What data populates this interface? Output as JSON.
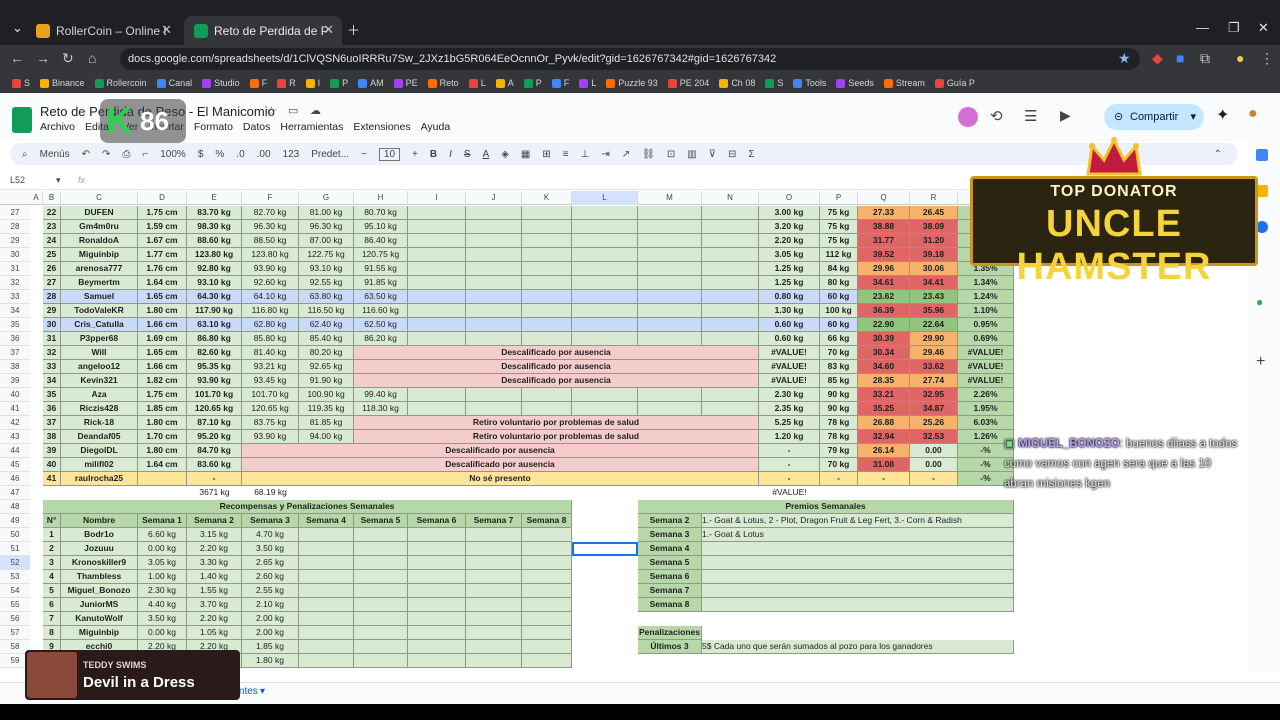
{
  "browser": {
    "tabs": [
      {
        "title": "RollerCoin – Online Bitcoin Mi",
        "active": false
      },
      {
        "title": "Reto de Perdida de Peso - El M",
        "active": true
      }
    ],
    "url": "docs.google.com/spreadsheets/d/1ClVQSN6uoIRRRu7Sw_2JXz1bG5R064EeOcnnOr_Pyvk/edit?gid=1626767342#gid=1626767342",
    "bookmarks": [
      "S",
      "Binance",
      "Rollercoin",
      "Canal",
      "Studio",
      "F",
      "R",
      "I",
      "P",
      "AM",
      "PE",
      "Reto",
      "L",
      "A",
      "P",
      "F",
      "L",
      "Puzzle 93",
      "PE 204",
      "Ch 08",
      "S",
      "Tools",
      "Seeds",
      "Stream",
      "Guía P"
    ]
  },
  "app": {
    "title": "Reto de Perdida de Peso - El Manicomio",
    "menus": [
      "Archivo",
      "Editar",
      "Ver",
      "Insertar",
      "Formato",
      "Datos",
      "Herramientas",
      "Extensiones",
      "Ayuda"
    ],
    "share_label": "Compartir",
    "toolbar": {
      "search": "Menús",
      "zoom": "100%",
      "currency": "$",
      "percent": "%",
      "dec_less": ".0",
      "dec_more": ".00",
      "num_format": "123",
      "font": "Predet...",
      "font_size": "10"
    },
    "cell_ref": "L52",
    "fx": "fx"
  },
  "overlay": {
    "k_letter": "K",
    "k_number": "86"
  },
  "columns": [
    "A",
    "B",
    "C",
    "D",
    "E",
    "F",
    "G",
    "H",
    "I",
    "J",
    "K",
    "L",
    "M",
    "N",
    "O",
    "P",
    "Q",
    "R"
  ],
  "rows": [
    {
      "n": "27",
      "B": "22",
      "C": "DUFEN",
      "D": "1.75 cm",
      "E": "83.70 kg",
      "F": "82.70 kg",
      "G": "81.00 kg",
      "H": "80.70 kg",
      "O": "3.00 kg",
      "P": "75 kg",
      "Q": "27.33",
      "R": "26.45",
      "S": "",
      "qc": "or",
      "rc": "or"
    },
    {
      "n": "28",
      "B": "23",
      "C": "Gm4m0ru",
      "D": "1.59 cm",
      "E": "98.30 kg",
      "F": "96.30 kg",
      "G": "96.30 kg",
      "H": "95.10 kg",
      "O": "3.20 kg",
      "P": "75 kg",
      "Q": "38.88",
      "R": "38.09",
      "S": "",
      "qc": "rd",
      "rc": "rd"
    },
    {
      "n": "29",
      "B": "24",
      "C": "RonaldoA",
      "D": "1.67 cm",
      "E": "88.60 kg",
      "F": "88.50 kg",
      "G": "87.00 kg",
      "H": "86.40 kg",
      "O": "2.20 kg",
      "P": "75 kg",
      "Q": "31.77",
      "R": "31.20",
      "S": "",
      "qc": "rd",
      "rc": "rd"
    },
    {
      "n": "30",
      "B": "25",
      "C": "Miguinbip",
      "D": "1.77 cm",
      "E": "123.80 kg",
      "F": "123.80 kg",
      "G": "122.75 kg",
      "H": "120.75 kg",
      "O": "3.05 kg",
      "P": "112 kg",
      "Q": "39.52",
      "R": "39.18",
      "S": "",
      "qc": "rd",
      "rc": "rd"
    },
    {
      "n": "31",
      "B": "26",
      "C": "arenosa777",
      "D": "1.76 cm",
      "E": "92.80 kg",
      "F": "93.90 kg",
      "G": "93.10 kg",
      "H": "91.55 kg",
      "O": "1.25 kg",
      "P": "84 kg",
      "Q": "29.96",
      "R": "30.06",
      "S": "1.35%",
      "qc": "or",
      "rc": "or"
    },
    {
      "n": "32",
      "B": "27",
      "C": "Beymertm",
      "D": "1.64 cm",
      "E": "93.10 kg",
      "F": "92.60 kg",
      "G": "92.55 kg",
      "H": "91.85 kg",
      "O": "1.25 kg",
      "P": "80 kg",
      "Q": "34.61",
      "R": "34.41",
      "S": "1.34%",
      "qc": "rd",
      "rc": "rd"
    },
    {
      "n": "33",
      "B": "28",
      "C": "Samuel",
      "D": "1.65 cm",
      "E": "64.30 kg",
      "F": "64.10 kg",
      "G": "63.80 kg",
      "H": "63.50 kg",
      "O": "0.80 kg",
      "P": "60 kg",
      "Q": "23.62",
      "R": "23.43",
      "S": "1.24%",
      "qc": "sg",
      "rc": "sg",
      "blue": true
    },
    {
      "n": "34",
      "B": "29",
      "C": "TodoValeKR",
      "D": "1.80 cm",
      "E": "117.90 kg",
      "F": "116.80 kg",
      "G": "116.50 kg",
      "H": "116.60 kg",
      "O": "1.30 kg",
      "P": "100 kg",
      "Q": "36.39",
      "R": "35.96",
      "S": "1.10%",
      "qc": "rd",
      "rc": "rd"
    },
    {
      "n": "35",
      "B": "30",
      "C": "Cris_Catulla",
      "D": "1.66 cm",
      "E": "63.10 kg",
      "F": "62.80 kg",
      "G": "62.40 kg",
      "H": "62.50 kg",
      "O": "0.60 kg",
      "P": "60 kg",
      "Q": "22.90",
      "R": "22.64",
      "S": "0.95%",
      "qc": "sg",
      "rc": "sg",
      "blue": true
    },
    {
      "n": "36",
      "B": "31",
      "C": "P3pper68",
      "D": "1.69 cm",
      "E": "86.80 kg",
      "F": "85.80 kg",
      "G": "85.40 kg",
      "H": "86.20 kg",
      "O": "0.60 kg",
      "P": "66 kg",
      "Q": "30.39",
      "R": "29.90",
      "S": "0.69%",
      "qc": "rd",
      "rc": "or"
    },
    {
      "n": "37",
      "B": "32",
      "C": "Will",
      "D": "1.65 cm",
      "E": "82.60 kg",
      "F": "81.40 kg",
      "G": "80.20 kg",
      "M": "Descalificado por ausencia",
      "mfrom": "H",
      "O": "#VALUE!",
      "P": "70 kg",
      "Q": "30.34",
      "R": "29.46",
      "S": "#VALUE!",
      "qc": "rd",
      "rc": "or"
    },
    {
      "n": "38",
      "B": "33",
      "C": "angeloo12",
      "D": "1.66 cm",
      "E": "95.35 kg",
      "F": "93.21 kg",
      "G": "92.65 kg",
      "M": "Descalificado por ausencia",
      "mfrom": "H",
      "O": "#VALUE!",
      "P": "83 kg",
      "Q": "34.60",
      "R": "33.62",
      "S": "#VALUE!",
      "qc": "rd",
      "rc": "rd"
    },
    {
      "n": "39",
      "B": "34",
      "C": "Kevin321",
      "D": "1.82 cm",
      "E": "93.90 kg",
      "F": "93.45 kg",
      "G": "91.90 kg",
      "M": "Descalificado por ausencia",
      "mfrom": "H",
      "O": "#VALUE!",
      "P": "85 kg",
      "Q": "28.35",
      "R": "27.74",
      "S": "#VALUE!",
      "qc": "or",
      "rc": "or"
    },
    {
      "n": "40",
      "B": "35",
      "C": "Aza",
      "D": "1.75 cm",
      "E": "101.70 kg",
      "F": "101.70 kg",
      "G": "100.90 kg",
      "H": "99.40 kg",
      "O": "2.30 kg",
      "P": "90 kg",
      "Q": "33.21",
      "R": "32.95",
      "S": "2.26%",
      "qc": "rd",
      "rc": "rd"
    },
    {
      "n": "41",
      "B": "36",
      "C": "Riczis428",
      "D": "1.85 cm",
      "E": "120.65 kg",
      "F": "120.65 kg",
      "G": "119.35 kg",
      "H": "118.30 kg",
      "O": "2.35 kg",
      "P": "90 kg",
      "Q": "35.25",
      "R": "34.87",
      "S": "1.95%",
      "qc": "rd",
      "rc": "rd"
    },
    {
      "n": "42",
      "B": "37",
      "C": "Rick-18",
      "D": "1.80 cm",
      "E": "87.10 kg",
      "F": "83.75 kg",
      "G": "81.85 kg",
      "M": "Retiro voluntario por problemas de salud",
      "mfrom": "H",
      "O": "5.25 kg",
      "P": "78 kg",
      "Q": "26.88",
      "R": "25.26",
      "S": "6.03%",
      "qc": "or",
      "rc": "or"
    },
    {
      "n": "43",
      "B": "38",
      "C": "Deandaf05",
      "D": "1.70 cm",
      "E": "95.20 kg",
      "F": "93.90 kg",
      "G": "94.00 kg",
      "M": "Retiro voluntario por problemas de salud",
      "mfrom": "H",
      "O": "1.20 kg",
      "P": "78 kg",
      "Q": "32.94",
      "R": "32.53",
      "S": "1.26%",
      "qc": "rd",
      "rc": "rd"
    },
    {
      "n": "44",
      "B": "39",
      "C": "DiegolDL",
      "D": "1.80 cm",
      "E": "84.70 kg",
      "M": "Descalificado por ausencia",
      "mfrom": "F",
      "O": "-",
      "P": "79 kg",
      "Q": "26.14",
      "R": "0.00",
      "S": "-%",
      "qc": "or",
      "rc": "g"
    },
    {
      "n": "45",
      "B": "40",
      "C": "milifl02",
      "D": "1.64 cm",
      "E": "83.60 kg",
      "M": "Descalificado por ausencia",
      "mfrom": "F",
      "O": "-",
      "P": "70 kg",
      "Q": "31.08",
      "R": "0.00",
      "S": "-%",
      "qc": "rd",
      "rc": "g"
    },
    {
      "n": "46",
      "B": "41",
      "C": "raulrocha25",
      "E": "-",
      "M": "No sé presento",
      "mfrom": "F",
      "O": "-",
      "P": "-",
      "Q": "-",
      "R": "-",
      "S": "-%",
      "qc": "yl",
      "rc": "yl",
      "yellow": true
    }
  ],
  "row47": {
    "n": "47",
    "E": "3671 kg",
    "F": "68.19 kg",
    "O": "#VALUE!"
  },
  "rewards": {
    "title": "Recompensas y Penalizaciones Semanales",
    "headers": [
      "N°",
      "Nombre",
      "Semana 1",
      "Semana 2",
      "Semana 3",
      "Semana 4",
      "Semana 5",
      "Semana 6",
      "Semana 7",
      "Semana 8"
    ],
    "rows": [
      [
        "1",
        "Bodr1o",
        "6.60 kg",
        "3.15 kg",
        "4.70 kg"
      ],
      [
        "2",
        "Jozuuu",
        "0.00 kg",
        "2.20 kg",
        "3.50 kg"
      ],
      [
        "3",
        "Kronoskiller9",
        "3.05 kg",
        "3.30 kg",
        "2.65 kg"
      ],
      [
        "4",
        "Thambless",
        "1.00 kg",
        "1.40 kg",
        "2.60 kg"
      ],
      [
        "5",
        "Miguel_Bonozo",
        "2.30 kg",
        "1.55 kg",
        "2.55 kg"
      ],
      [
        "6",
        "JuniorMS",
        "4.40 kg",
        "3.70 kg",
        "2.10 kg"
      ],
      [
        "7",
        "KanutoWolf",
        "3.50 kg",
        "2.20 kg",
        "2.00 kg"
      ],
      [
        "8",
        "Miguinbip",
        "0.00 kg",
        "1.05 kg",
        "2.00 kg"
      ],
      [
        "9",
        "ecchi0",
        "2.20 kg",
        "2.20 kg",
        "1.85 kg"
      ],
      [
        "",
        "",
        "",
        "",
        "1.80 kg"
      ]
    ],
    "row_numbers": [
      "48",
      "49",
      "50",
      "51",
      "52",
      "53",
      "54",
      "55",
      "56",
      "57",
      "58",
      "59"
    ]
  },
  "prizes": {
    "title": "Premios Semanales",
    "rows": [
      [
        "Semana 2",
        "1.- Goat & Lotus, 2 - Plot, Dragon Fruit & Leg Fert, 3.- Corn & Radish"
      ],
      [
        "Semana 3",
        "1.- Goat & Lotus"
      ],
      [
        "Semana 4",
        ""
      ],
      [
        "Semana 5",
        ""
      ],
      [
        "Semana 6",
        ""
      ],
      [
        "Semana 7",
        ""
      ],
      [
        "Semana 8",
        ""
      ]
    ],
    "penal_label": "Penalizaciones",
    "penal_week": "Últimos 3",
    "penal_text": "5$ Cada uno que serán sumados al pozo para los ganadores"
  },
  "stream": {
    "banner_top": "TOP DONATOR",
    "banner_name": "UNCLE HAMSTER",
    "chat_user": "MIGUEL_BONOZO",
    "chat_text": ": buenos diiass a todos como vamos con agen sera que a las 10 abran misiones kgen",
    "music_artist": "TEDDY SWIMS",
    "music_song": "Devil in a Dress",
    "sheet_tab": "Participantes"
  }
}
